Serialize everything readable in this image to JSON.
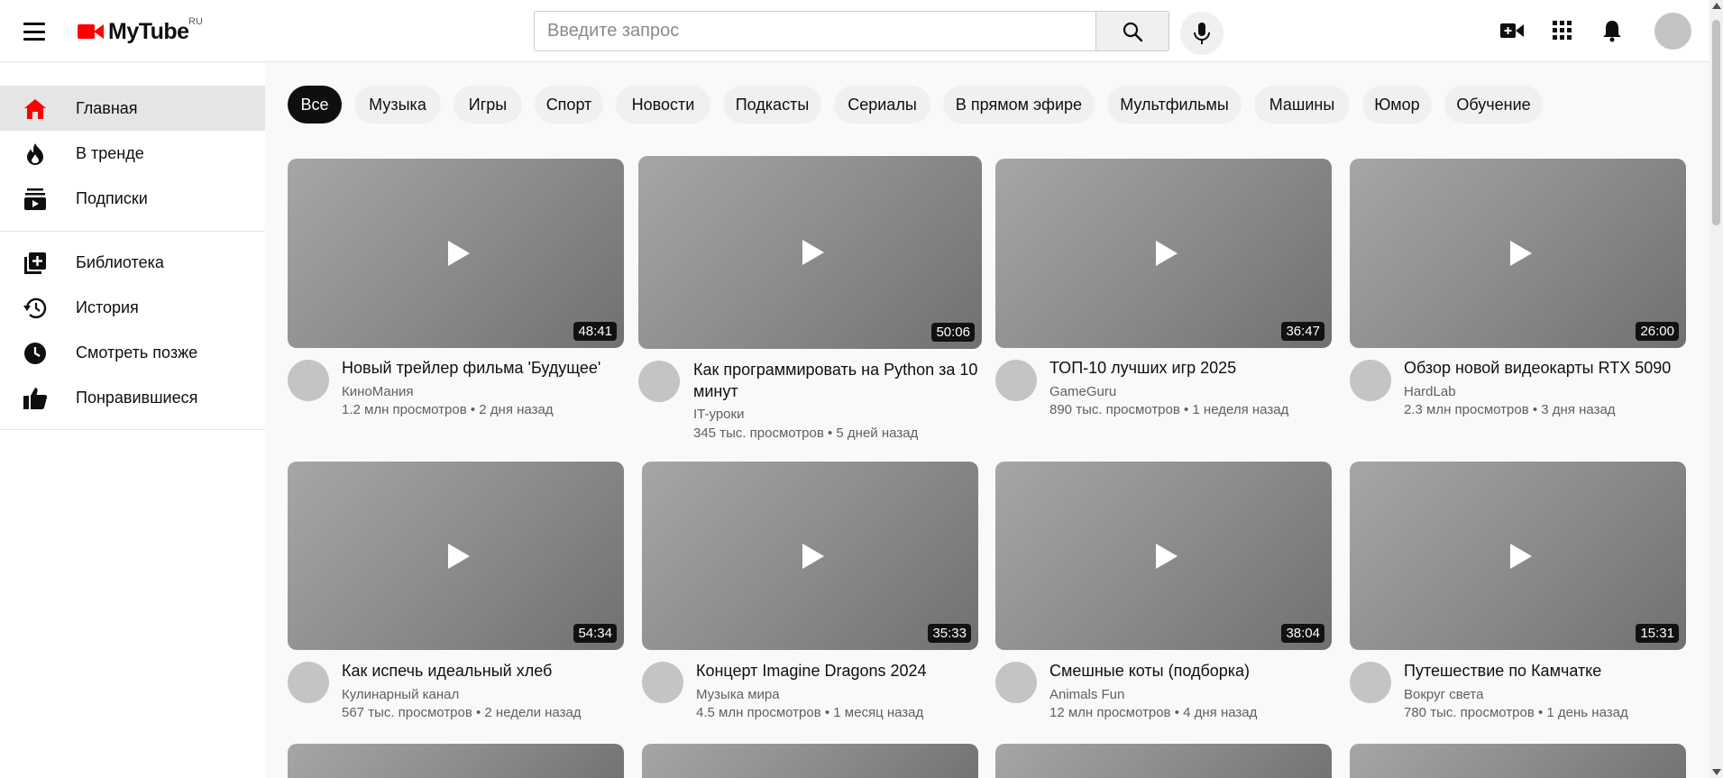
{
  "header": {
    "logo_text": "MyTube",
    "logo_region": "RU",
    "search_placeholder": "Введите запрос",
    "icons": [
      "menu-icon",
      "search-icon",
      "mic-icon",
      "create-video-icon",
      "apps-grid-icon",
      "bell-icon"
    ]
  },
  "colors": {
    "brand_red": "#ff0000",
    "active_chip_bg": "#0f0f0f",
    "chip_bg": "#f0f0f0",
    "active_nav_bg": "#e5e5e5",
    "meta_text": "#606060"
  },
  "sidebar": {
    "items": [
      {
        "label": "Главная",
        "icon": "home-icon",
        "active": true
      },
      {
        "label": "В тренде",
        "icon": "trending-flame-icon",
        "active": false
      },
      {
        "label": "Подписки",
        "icon": "subscriptions-icon",
        "active": false
      },
      {
        "label": "Библиотека",
        "icon": "library-add-icon",
        "active": false
      },
      {
        "label": "История",
        "icon": "history-icon",
        "active": false
      },
      {
        "label": "Смотреть позже",
        "icon": "watch-later-clock-icon",
        "active": false
      },
      {
        "label": "Понравившиеся",
        "icon": "thumb-up-icon",
        "active": false
      }
    ]
  },
  "chips": [
    {
      "label": "Все",
      "active": true
    },
    {
      "label": "Музыка"
    },
    {
      "label": "Игры"
    },
    {
      "label": "Спорт"
    },
    {
      "label": "Новости"
    },
    {
      "label": "Подкасты"
    },
    {
      "label": "Сериалы"
    },
    {
      "label": "В прямом эфире"
    },
    {
      "label": "Мультфильмы"
    },
    {
      "label": "Машины"
    },
    {
      "label": "Юмор"
    },
    {
      "label": "Обучение"
    }
  ],
  "videos": [
    {
      "title": "Новый трейлер фильма 'Будущее'",
      "channel": "КиноМания",
      "meta": "1.2 млн просмотров • 2 дня назад",
      "duration": "48:41"
    },
    {
      "title": "Как программировать на Python за 10 минут",
      "channel": "IT-уроки",
      "meta": "345 тыс. просмотров • 5 дней назад",
      "duration": "50:06"
    },
    {
      "title": "ТОП-10 лучших игр 2025",
      "channel": "GameGuru",
      "meta": "890 тыс. просмотров • 1 неделя назад",
      "duration": "36:47"
    },
    {
      "title": "Обзор новой видеокарты RTX 5090",
      "channel": "HardLab",
      "meta": "2.3 млн просмотров • 3 дня назад",
      "duration": "26:00"
    },
    {
      "title": "Как испечь идеальный хлеб",
      "channel": "Кулинарный канал",
      "meta": "567 тыс. просмотров • 2 недели назад",
      "duration": "54:34"
    },
    {
      "title": "Концерт Imagine Dragons 2024",
      "channel": "Музыка мира",
      "meta": "4.5 млн просмотров • 1 месяц назад",
      "duration": "35:33"
    },
    {
      "title": "Смешные коты (подборка)",
      "channel": "Animals Fun",
      "meta": "12 млн просмотров • 4 дня назад",
      "duration": "38:04"
    },
    {
      "title": "Путешествие по Камчатке",
      "channel": "Вокруг света",
      "meta": "780 тыс. просмотров • 1 день назад",
      "duration": "15:31"
    }
  ]
}
